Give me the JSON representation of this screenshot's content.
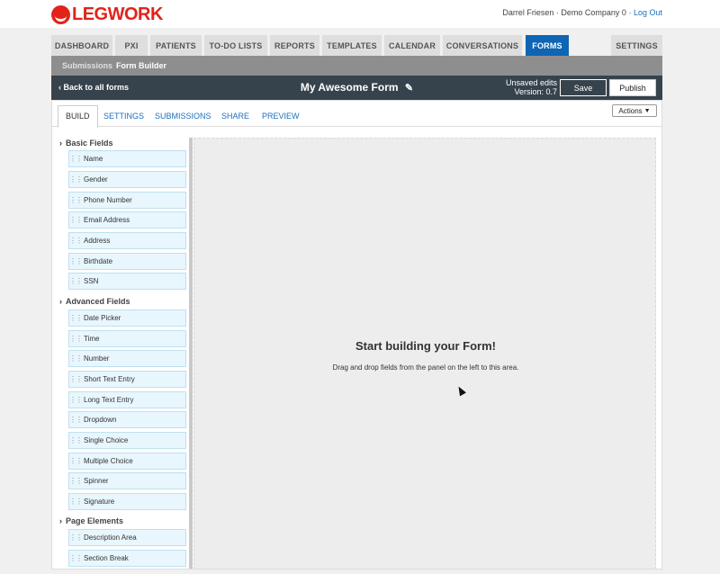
{
  "brand": {
    "name": "LEGWORK",
    "color": "#e2231a"
  },
  "user": {
    "name": "Darrel Friesen",
    "separator": "·",
    "company": "Demo Company 0",
    "logout": "Log Out"
  },
  "nav": {
    "tabs": [
      "DASHBOARD",
      "PXI",
      "PATIENTS",
      "TO-DO LISTS",
      "REPORTS",
      "TEMPLATES",
      "CALENDAR",
      "CONVERSATIONS",
      "FORMS"
    ],
    "settings": "SETTINGS",
    "active": "FORMS",
    "active_color": "#0d65b3"
  },
  "subnav": {
    "item1": "Submissions",
    "item2": "Form Builder"
  },
  "toolbar": {
    "back": "Back to all forms",
    "form_title": "My Awesome Form",
    "unsaved": "Unsaved edits",
    "version": "Version: 0.7",
    "save": "Save",
    "publish": "Publish"
  },
  "builder_tabs": [
    "BUILD",
    "SETTINGS",
    "SUBMISSIONS",
    "SHARE",
    "PREVIEW"
  ],
  "actions_label": "Actions",
  "field_groups": [
    {
      "title": "Basic Fields",
      "items": [
        "Name",
        "Gender",
        "Phone Number",
        "Email Address",
        "Address",
        "Birthdate",
        "SSN"
      ]
    },
    {
      "title": "Advanced Fields",
      "items": [
        "Date Picker",
        "Time",
        "Number",
        "Short Text Entry",
        "Long Text Entry",
        "Dropdown",
        "Single Choice",
        "Multiple Choice",
        "Spinner",
        "Signature"
      ]
    },
    {
      "title": "Page Elements",
      "items": [
        "Description Area",
        "Section Break"
      ]
    }
  ],
  "dropzone": {
    "title": "Start building your Form!",
    "subtitle": "Drag and drop fields from the panel on the left to this area."
  }
}
